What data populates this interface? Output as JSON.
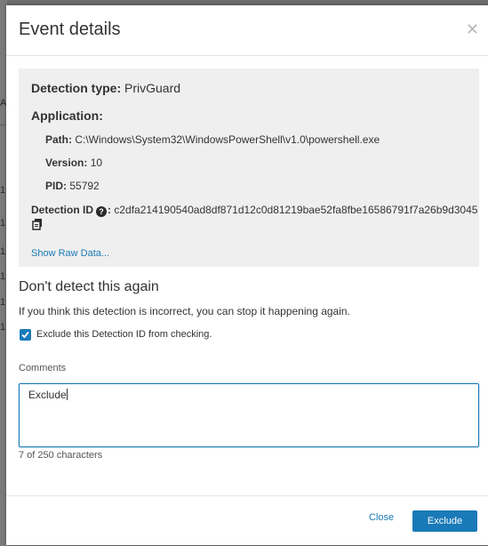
{
  "background": {
    "fragments": [
      "AF",
      "1",
      "1",
      "1",
      "1",
      "1",
      "1"
    ]
  },
  "dialog": {
    "title": "Event details",
    "close_icon": "close-icon"
  },
  "details": {
    "detection_type_label": "Detection type:",
    "detection_type_value": "PrivGuard",
    "application_label": "Application:",
    "path_label": "Path:",
    "path_value": "C:\\Windows\\System32\\WindowsPowerShell\\v1.0\\powershell.exe",
    "version_label": "Version:",
    "version_value": "10",
    "pid_label": "PID:",
    "pid_value": "55792",
    "detection_id_label": "Detection ID",
    "detection_id_value": "c2dfa214190540ad8df871d12c0d81219bae52fa8fbe16586791f7a26b9d3045",
    "help_icon": "question-icon",
    "copy_icon": "copy-icon",
    "raw_data_link": "Show Raw Data..."
  },
  "exclusion": {
    "title": "Don't detect this again",
    "description": "If you think this detection is incorrect, you can stop it happening again.",
    "checkbox_label": "Exclude this Detection ID from checking.",
    "checkbox_checked": true,
    "comments_label": "Comments",
    "comments_value": "Exclude",
    "char_count": "7 of 250 characters"
  },
  "footer": {
    "close_label": "Close",
    "exclude_label": "Exclude"
  },
  "colors": {
    "accent": "#1a7ab8",
    "panel_bg": "#efefef"
  }
}
